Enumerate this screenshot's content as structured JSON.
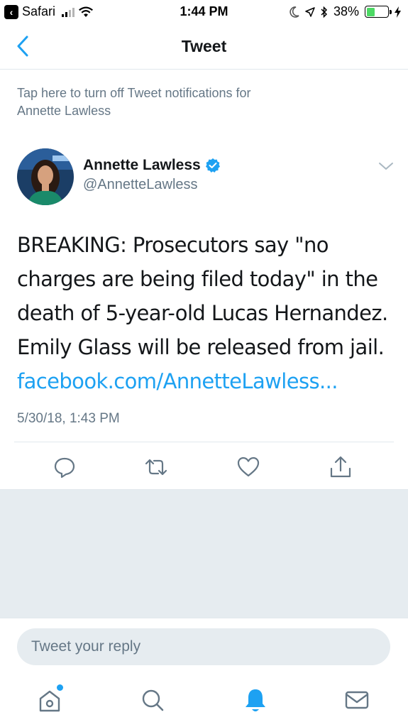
{
  "status_bar": {
    "back_app": "Safari",
    "time": "1:44 PM",
    "battery_percent_label": "38%",
    "battery_level": 0.38
  },
  "nav": {
    "title": "Tweet"
  },
  "notification_banner": {
    "text_line1": "Tap here to turn off Tweet notifications for",
    "text_line2": "Annette Lawless"
  },
  "tweet": {
    "author_name": "Annette Lawless",
    "author_handle": "@AnnetteLawless",
    "verified": true,
    "text_line1": "BREAKING: Prosecutors say \"no",
    "text_line2": "charges are being filed today\" in the",
    "text_line3": "death of 5-year-old Lucas Hernandez.",
    "text_line4": "Emily Glass will be released from jail.",
    "link": "facebook.com/AnnetteLawless...",
    "timestamp": "5/30/18, 1:43 PM",
    "actions": [
      "reply",
      "retweet",
      "like",
      "share"
    ]
  },
  "reply": {
    "placeholder": "Tweet your reply"
  },
  "tab_bar": {
    "tabs": [
      "home",
      "search",
      "notifications",
      "messages"
    ],
    "active": "notifications"
  },
  "colors": {
    "accent": "#1da1f2",
    "secondary_text": "#657786",
    "background_gray": "#e6ecf0"
  }
}
